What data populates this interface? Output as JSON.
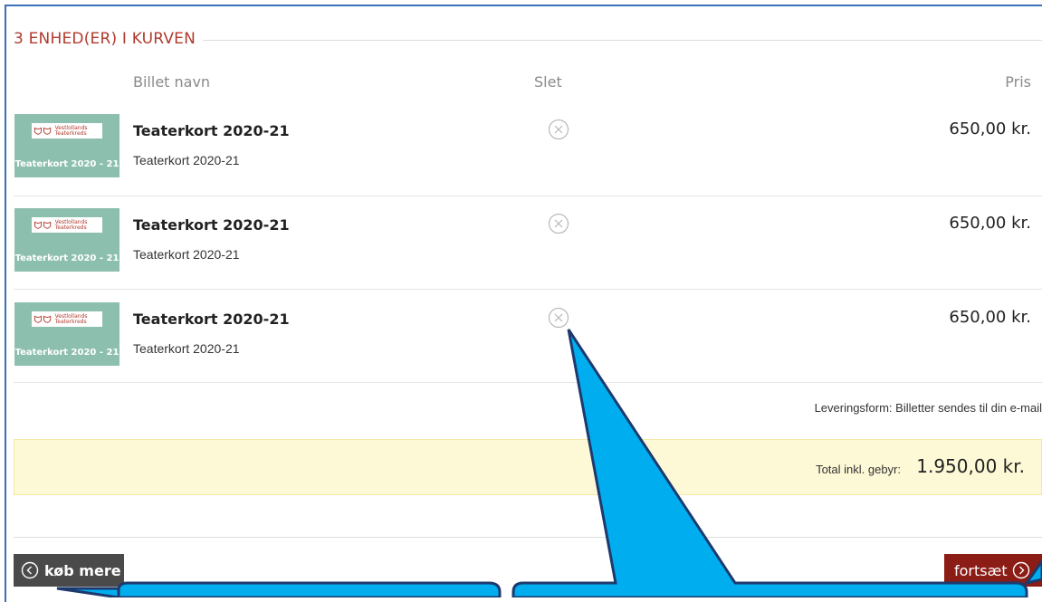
{
  "cart": {
    "heading": "3 ENHED(ER) I KURVEN",
    "columns": {
      "name": "Billet navn",
      "delete": "Slet",
      "price": "Pris"
    },
    "items": [
      {
        "title": "Teaterkort 2020-21",
        "subtitle": "Teaterkort 2020-21",
        "price": "650,00 kr.",
        "thumb_caption": "Teaterkort 2020 - 21",
        "logo_text": "Vestlollands Teaterkreds"
      },
      {
        "title": "Teaterkort 2020-21",
        "subtitle": "Teaterkort 2020-21",
        "price": "650,00 kr.",
        "thumb_caption": "Teaterkort 2020 - 21",
        "logo_text": "Vestlollands Teaterkreds"
      },
      {
        "title": "Teaterkort 2020-21",
        "subtitle": "Teaterkort 2020-21",
        "price": "650,00 kr.",
        "thumb_caption": "Teaterkort 2020 - 21",
        "logo_text": "Vestlollands Teaterkreds"
      }
    ],
    "delivery": "Leveringsform: Billetter sendes til din e-mail",
    "total_label": "Total inkl. gebyr:",
    "total_value": "1.950,00 kr."
  },
  "actions": {
    "back_label": "køb mere",
    "next_label": "fortsæt"
  },
  "icons": {
    "delete": "close-circle-icon",
    "back": "chevron-left-circle-icon",
    "next": "chevron-right-circle-icon",
    "logo": "theatre-masks-icon"
  },
  "colors": {
    "heading": "#b03a2e",
    "thumb_bg": "#8dbfae",
    "total_bg": "#fdf9d6",
    "back_button": "#4a4a4a",
    "next_button": "#8b1c16",
    "callout": "#00a8e8"
  }
}
